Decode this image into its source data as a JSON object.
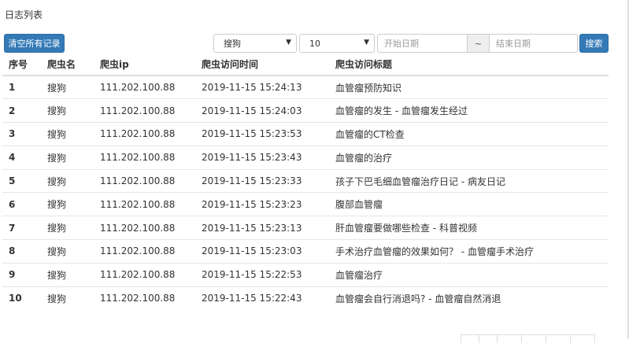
{
  "page": {
    "title": "日志列表"
  },
  "toolbar": {
    "clear_label": "清空所有记录",
    "crawler_select": "搜狗",
    "page_size_select": "10",
    "start_date_placeholder": "开始日期",
    "date_separator": "~",
    "end_date_placeholder": "结束日期",
    "search_label": "搜索"
  },
  "table": {
    "headers": [
      "序号",
      "爬虫名",
      "爬虫ip",
      "爬虫访问时间",
      "爬虫访问标题"
    ],
    "rows": [
      [
        "1",
        "搜狗",
        "111.202.100.88",
        "2019-11-15 15:24:13",
        "血管瘤预防知识"
      ],
      [
        "2",
        "搜狗",
        "111.202.100.88",
        "2019-11-15 15:24:03",
        "血管瘤的发生 - 血管瘤发生经过"
      ],
      [
        "3",
        "搜狗",
        "111.202.100.88",
        "2019-11-15 15:23:53",
        "血管瘤的CT检查"
      ],
      [
        "4",
        "搜狗",
        "111.202.100.88",
        "2019-11-15 15:23:43",
        "血管瘤的治疗"
      ],
      [
        "5",
        "搜狗",
        "111.202.100.88",
        "2019-11-15 15:23:33",
        "孩子下巴毛细血管瘤治疗日记 - 病友日记"
      ],
      [
        "6",
        "搜狗",
        "111.202.100.88",
        "2019-11-15 15:23:23",
        "腹部血管瘤"
      ],
      [
        "7",
        "搜狗",
        "111.202.100.88",
        "2019-11-15 15:23:13",
        "肝血管瘤要做哪些检查 - 科普视频"
      ],
      [
        "8",
        "搜狗",
        "111.202.100.88",
        "2019-11-15 15:23:03",
        "手术治疗血管瘤的效果如何？ - 血管瘤手术治疗"
      ],
      [
        "9",
        "搜狗",
        "111.202.100.88",
        "2019-11-15 15:22:53",
        "血管瘤治疗"
      ],
      [
        "10",
        "搜狗",
        "111.202.100.88",
        "2019-11-15 15:22:43",
        "血管瘤会自行消退吗? - 血管瘤自然消退"
      ]
    ]
  },
  "colors": {
    "primary": "#337ab7",
    "border": "#dddddd",
    "text": "#333333"
  }
}
